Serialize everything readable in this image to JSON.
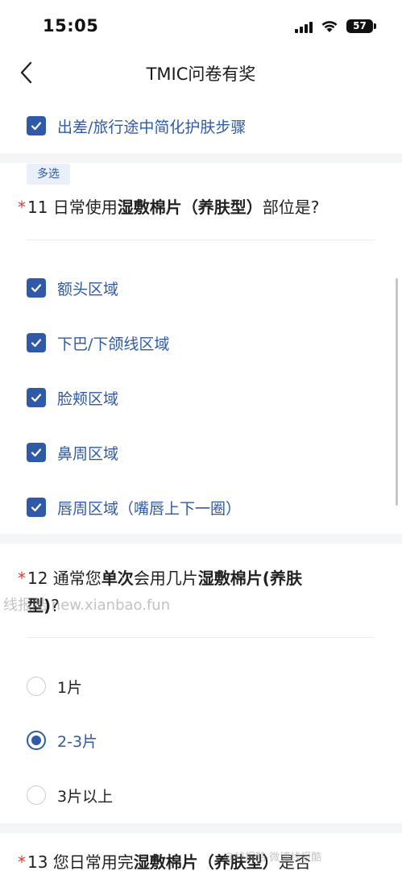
{
  "status_bar": {
    "time": "15:05",
    "battery": "57"
  },
  "nav": {
    "title": "TMIC问卷有奖"
  },
  "prev_option": {
    "label": "出差/旅行途中简化护肤步骤",
    "checked": true
  },
  "q11": {
    "tag": "多选",
    "required_mark": "*",
    "title_parts": [
      "11 日常使用",
      "湿敷棉片（养肤型）",
      "部位是?"
    ],
    "options": [
      {
        "label": "额头区域",
        "checked": true
      },
      {
        "label": "下巴/下颌线区域",
        "checked": true
      },
      {
        "label": "脸颊区域",
        "checked": true
      },
      {
        "label": "鼻周区域",
        "checked": true
      },
      {
        "label": "唇周区域（嘴唇上下一圈）",
        "checked": true
      }
    ]
  },
  "q12": {
    "required_mark": "*",
    "title_parts": [
      "12 通常您",
      "单次",
      "会用几片",
      "湿敷棉片(养肤",
      "型)",
      "?"
    ],
    "options": [
      {
        "label": "1片",
        "selected": false
      },
      {
        "label": "2-3片",
        "selected": true
      },
      {
        "label": "3片以上",
        "selected": false
      }
    ]
  },
  "q13": {
    "required_mark": "*",
    "title_parts": [
      "13 您日常用完",
      "湿敷棉片（养肤型）",
      "是否"
    ]
  },
  "watermarks": {
    "main": "线报酷 new.xianbao.fun",
    "corner": "@线报酷 微博线报酷"
  },
  "colors": {
    "accent": "#2f5aa8",
    "required": "#e03a3a",
    "tag_bg": "#e9f0fb",
    "section_gap": "#f4f5f7"
  }
}
